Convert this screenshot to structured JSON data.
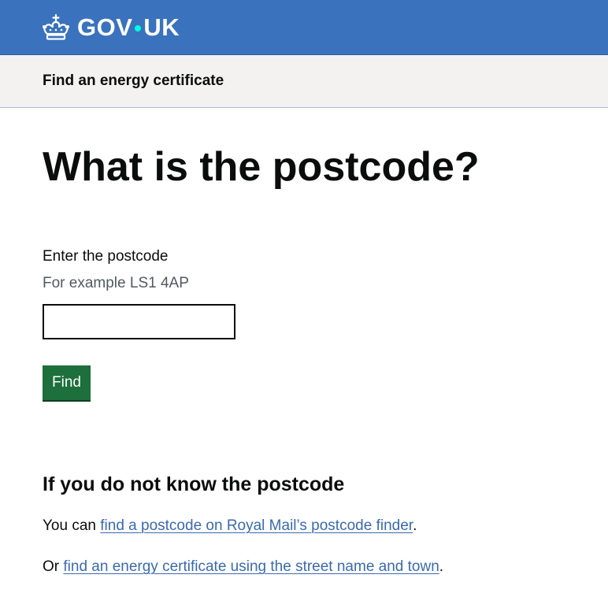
{
  "header": {
    "logo_text_left": "GOV",
    "logo_text_right": "UK",
    "brand_color": "#3a72bd",
    "logo_dot_color": "#00ffe0",
    "crown_icon": "crown-icon"
  },
  "service": {
    "name": "Find an energy certificate"
  },
  "page": {
    "title": "What is the postcode?"
  },
  "form": {
    "label": "Enter the postcode",
    "hint": "For example LS1 4AP",
    "postcode_value": "",
    "button_label": "Find",
    "button_color": "#1d6f3b"
  },
  "help": {
    "heading": "If you do not know the postcode",
    "para1_prefix": "You can ",
    "para1_link": "find a postcode on Royal Mail’s postcode finder",
    "para1_suffix": ".",
    "para2_prefix": "Or ",
    "para2_link": "find an energy certificate using the street name and town",
    "para2_suffix": ".",
    "link_color": "#3a6ab0"
  }
}
